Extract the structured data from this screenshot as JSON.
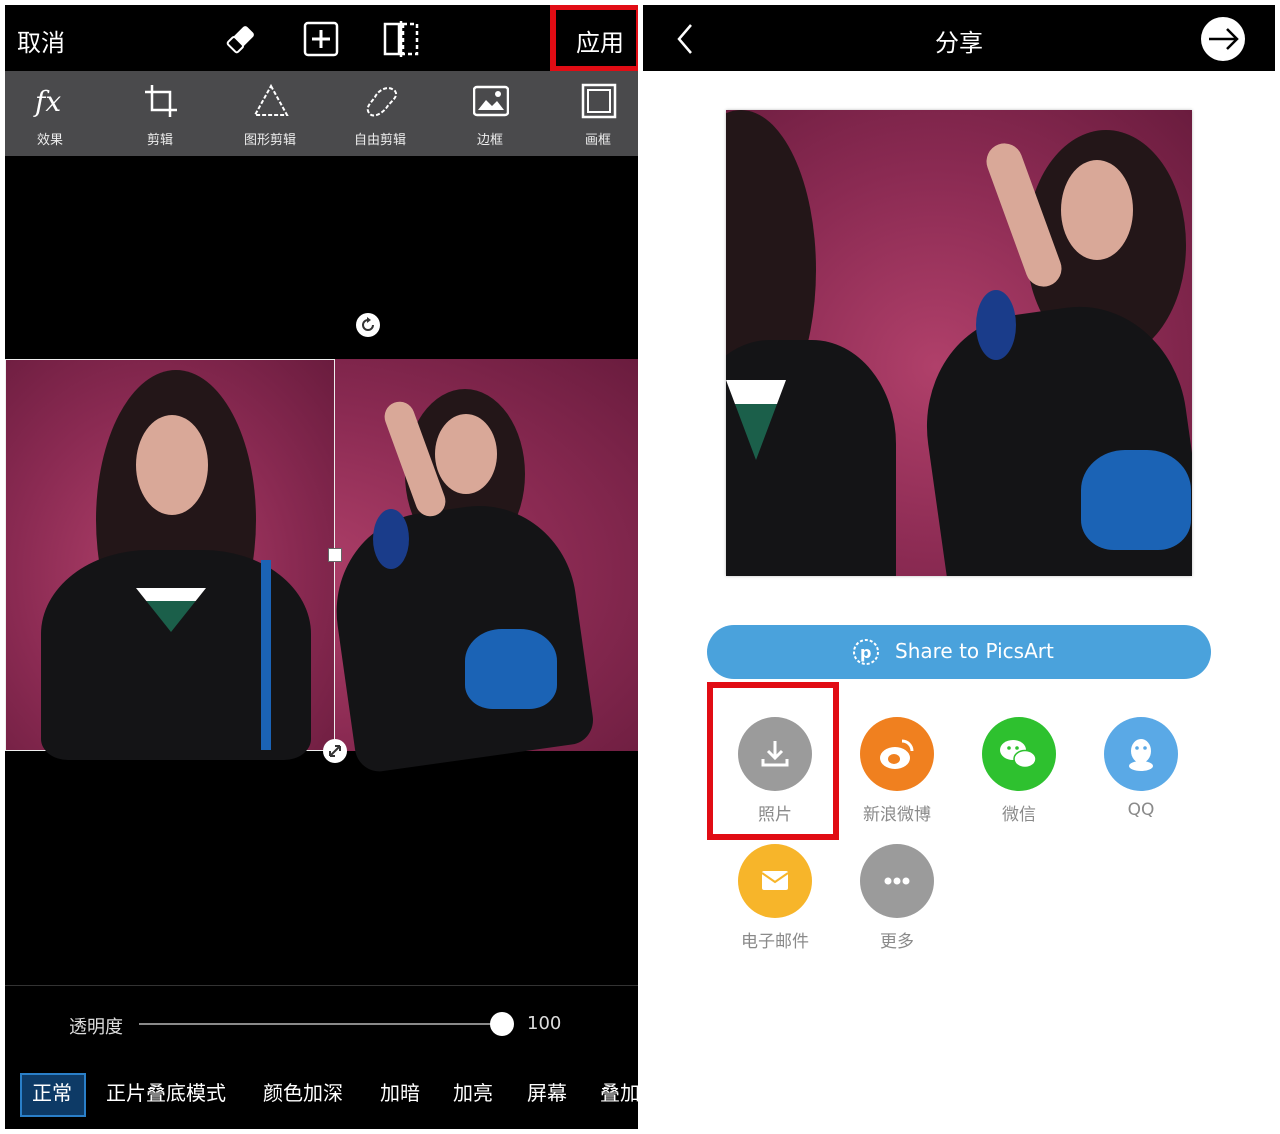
{
  "editor": {
    "cancel_label": "取消",
    "apply_label": "应用",
    "tools": [
      {
        "label": "效果",
        "icon": "fx-icon"
      },
      {
        "label": "剪辑",
        "icon": "crop-icon"
      },
      {
        "label": "图形剪辑",
        "icon": "shape-crop-icon"
      },
      {
        "label": "自由剪辑",
        "icon": "free-crop-icon"
      },
      {
        "label": "边框",
        "icon": "border-icon"
      },
      {
        "label": "画框",
        "icon": "frame-icon"
      }
    ],
    "opacity_label": "透明度",
    "opacity_value": "100",
    "opacity_level": 1.0,
    "blend_modes": [
      "正常",
      "正片叠底模式",
      "颜色加深",
      "加暗",
      "加亮",
      "屏幕",
      "叠加"
    ],
    "selected_blend_mode": "正常"
  },
  "share": {
    "title": "分享",
    "share_picsart_label": "Share to PicsArt",
    "targets": [
      {
        "label": "照片",
        "icon": "download-icon",
        "color": "#9b9b9b"
      },
      {
        "label": "新浪微博",
        "icon": "weibo-icon",
        "color": "#f0801f"
      },
      {
        "label": "微信",
        "icon": "wechat-icon",
        "color": "#2ec12f"
      },
      {
        "label": "QQ",
        "icon": "qq-icon",
        "color": "#5aa9e6"
      },
      {
        "label": "电子邮件",
        "icon": "mail-icon",
        "color": "#f7b52a"
      },
      {
        "label": "更多",
        "icon": "more-icon",
        "color": "#9b9b9b"
      }
    ]
  },
  "colors": {
    "highlight": "#e10c14",
    "share_button": "#4aa2dc",
    "toolbar": "#4a4a4c"
  }
}
